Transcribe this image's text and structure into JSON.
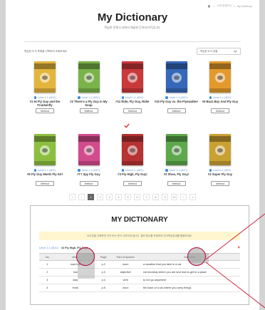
{
  "breadcrumb": [
    "홈",
    "나의 추천도서",
    "My Dictionary"
  ],
  "page": {
    "title": "My Dictionary",
    "subtitle": "학습한 전체 도서에서 채굴한 단어리스트입니다."
  },
  "filter": {
    "text": "학습한 도서 목록을 선택하여 조회하세요",
    "sort_label": "학습한 도서 정렬"
  },
  "books": [
    {
      "level": "Level 1-1 (4DC)",
      "title": "#1 Hi Fly Guy and the Frankenfly",
      "method": "Method",
      "color": "#e4b53d"
    },
    {
      "level": "Level 1-1 (4DC)",
      "title": "#2 There's a Fly Guy in My Soup",
      "method": "Method",
      "color": "#7ab34a"
    },
    {
      "level": "Level 1-1 (4DC)",
      "title": "#11 Ride, Fly Guy, Ride!",
      "method": "Method",
      "color": "#c9393a"
    },
    {
      "level": "Level 1-1 (4DC)",
      "title": "#10 Fly Guy vs. the Flyswatter!",
      "method": "Method",
      "color": "#3568b8"
    },
    {
      "level": "Level 1-1 (4DC)",
      "title": "#9 Buzz Boy And Fly Guy",
      "method": "Method",
      "color": "#e39a2d"
    },
    {
      "level": "Level 1-1 (4DC)",
      "title": "#6 Fly Guy Meets Fly Girl",
      "method": "Method",
      "color": "#8cbf3f"
    },
    {
      "level": "Level 1-1 (4DC)",
      "title": "#7 I Spy Fly Guy",
      "method": "Method",
      "color": "#d24b8d"
    },
    {
      "level": "Level 1-1 (4DC)",
      "title": "#3 Fly High, Fly Guy!",
      "method": "Method",
      "color": "#b73232"
    },
    {
      "level": "Level 1-1 (4DC)",
      "title": "#3 Shoo, Fly Guy!",
      "method": "Method",
      "color": "#5ca84a"
    },
    {
      "level": "Level 1-1 (4DC)",
      "title": "#2 Super Fly Guy",
      "method": "Method",
      "color": "#c9a032"
    }
  ],
  "pagination": {
    "prev2": "«",
    "prev": "‹",
    "pages": [
      "1",
      "2",
      "3",
      "4",
      "5",
      "6",
      "7",
      "8",
      "9",
      "10"
    ],
    "active": "1",
    "next": "›",
    "next2": "»"
  },
  "dictionary": {
    "title": "MY DICTIONARY",
    "note": "아이콘을 선택하면 단어 또는 뜻이 사라지게 됩니다. 클릭 횟수를 조정하여 단어학습효과를 활용하세요.",
    "level": "Level 1-1 (4DC)",
    "book": "#3 Fly High, Fly Guy!",
    "close": "×",
    "columns": [
      "No",
      "Word",
      "Page",
      "Part of Speech",
      "Definition"
    ],
    "rows": [
      {
        "no": "1",
        "word": "road trip",
        "page": "p.2",
        "pos": "noun",
        "def": "a vacation that you take in a car"
      },
      {
        "no": "2",
        "word": "lost",
        "page": "p.3",
        "pos": "adjective",
        "def": "not knowing where you are and how to get to a place"
      },
      {
        "no": "3",
        "word": "stay",
        "page": "p.4",
        "pos": "verb",
        "def": "to not go anywhere"
      },
      {
        "no": "4",
        "word": "trunk",
        "page": "p.5",
        "pos": "noun",
        "def": "the back of a car where you carry things"
      }
    ]
  },
  "colors": {
    "accent": "#3a8de0",
    "active_page": "#666666",
    "note_bg": "#fff6cf",
    "callout": "#cc1a3a"
  }
}
